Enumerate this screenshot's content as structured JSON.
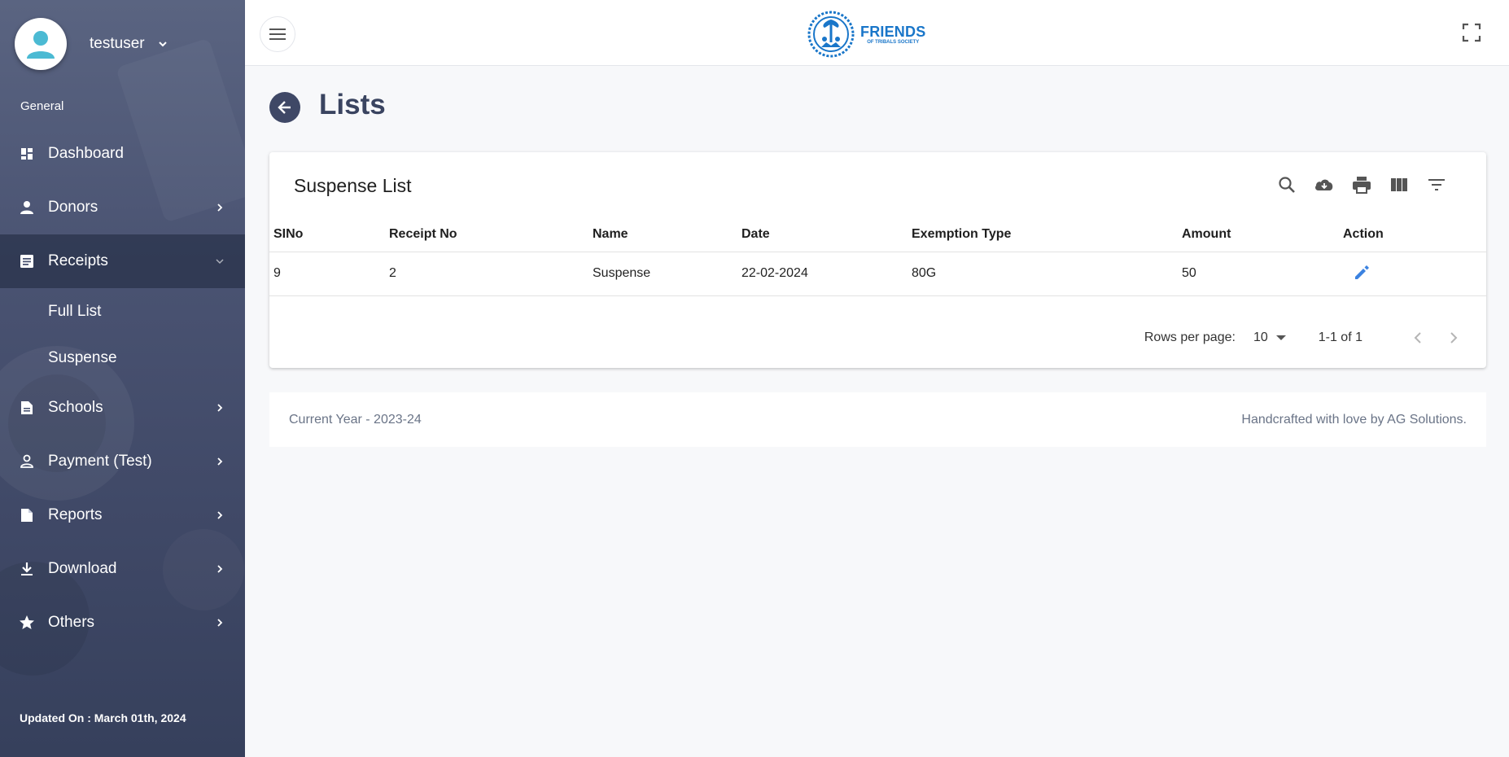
{
  "user": {
    "name": "testuser"
  },
  "sidebar": {
    "section_label": "General",
    "items": [
      {
        "label": "Dashboard",
        "icon": "dashboard-icon"
      },
      {
        "label": "Donors",
        "icon": "person-icon"
      },
      {
        "label": "Receipts",
        "icon": "receipt-icon"
      },
      {
        "label": "Schools",
        "icon": "document-icon"
      },
      {
        "label": "Payment (Test)",
        "icon": "person-outline-icon"
      },
      {
        "label": "Reports",
        "icon": "file-icon"
      },
      {
        "label": "Download",
        "icon": "download-icon"
      },
      {
        "label": "Others",
        "icon": "star-icon"
      }
    ],
    "receipts_sub": [
      {
        "label": "Full List"
      },
      {
        "label": "Suspense"
      }
    ],
    "updated_on": "Updated On : March 01th, 2024"
  },
  "header": {
    "logo_title": "FRIENDS",
    "logo_subtitle": "OF TRIBALS SOCIETY"
  },
  "page": {
    "title": "Lists"
  },
  "card": {
    "title": "Suspense List",
    "columns": [
      "SINo",
      "Receipt No",
      "Name",
      "Date",
      "Exemption Type",
      "Amount",
      "Action"
    ],
    "rows": [
      {
        "sino": "9",
        "receipt_no": "2",
        "name": "Suspense",
        "date": "22-02-2024",
        "exemption_type": "80G",
        "amount": "50"
      }
    ],
    "pagination": {
      "rows_per_page_label": "Rows per page:",
      "rows_per_page_value": "10",
      "range": "1-1 of 1"
    }
  },
  "footer": {
    "left": "Current Year - 2023-24",
    "right": "Handcrafted with love by AG Solutions."
  },
  "colors": {
    "sidebar": "#4a5372",
    "accent_blue": "#1976c9",
    "edit_icon": "#3b82e0",
    "title": "#3a4460"
  }
}
